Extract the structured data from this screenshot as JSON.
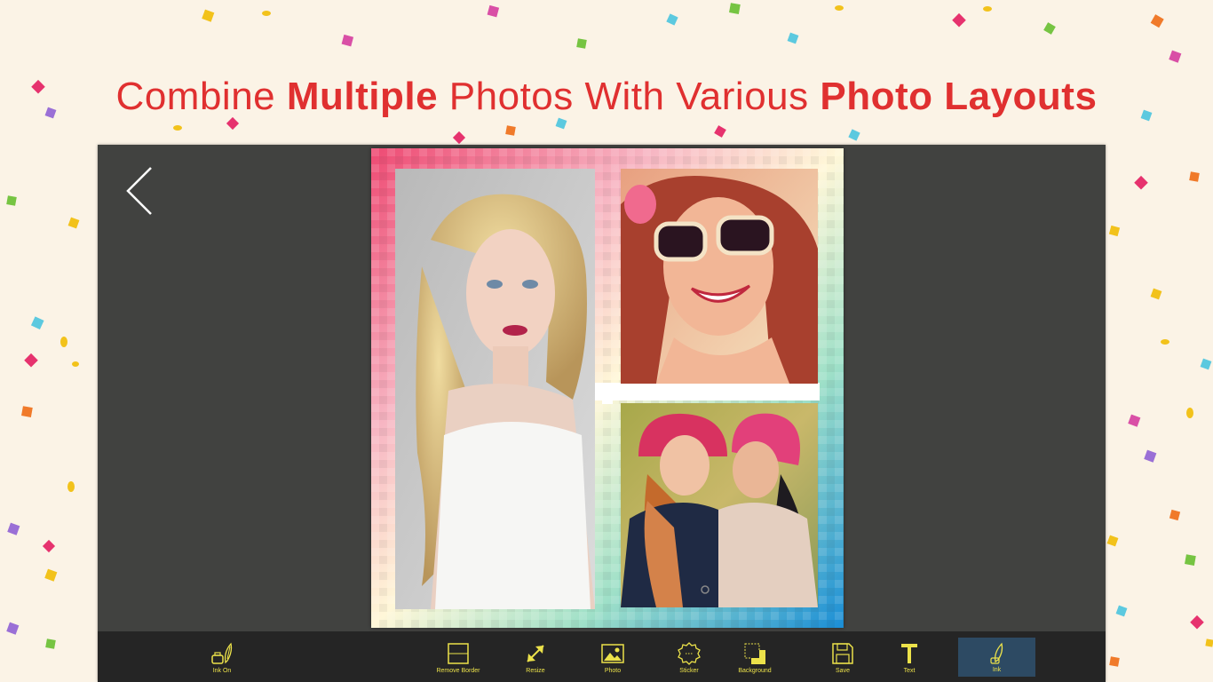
{
  "headline": {
    "part1": "Combine ",
    "bold1": "Multiple",
    "part2": " Photos With Various ",
    "bold2": "Photo Layouts"
  },
  "colors": {
    "headline": "#e03030",
    "app_background": "#414240",
    "toolbar_background": "#252525",
    "toolbar_icon": "#ece24a",
    "active_tool": "#2d4a63"
  },
  "toolbar": {
    "ink_on": "Ink On",
    "tools": [
      {
        "label": "Remove Border",
        "icon": "square-icon"
      },
      {
        "label": "Resize",
        "icon": "resize-arrows-icon"
      },
      {
        "label": "Photo",
        "icon": "image-icon"
      },
      {
        "label": "Sticker",
        "icon": "sticker-badge-icon"
      },
      {
        "label": "Background",
        "icon": "background-squares-icon"
      },
      {
        "label": "Save",
        "icon": "floppy-disk-icon"
      },
      {
        "label": "Text",
        "icon": "text-t-icon"
      },
      {
        "label": "Ink",
        "icon": "ink-pen-icon"
      }
    ],
    "active_tool": "Ink"
  }
}
